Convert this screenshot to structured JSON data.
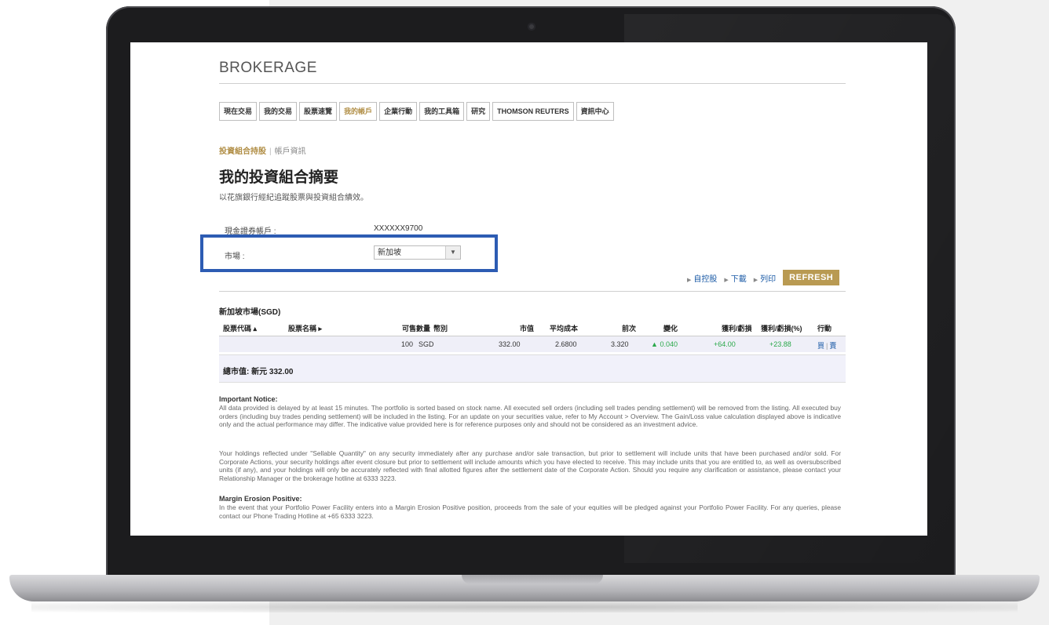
{
  "app": {
    "brand": "BROKERAGE"
  },
  "tabs": [
    {
      "label": "現在交易",
      "active": false
    },
    {
      "label": "我的交易",
      "active": false
    },
    {
      "label": "股票速覽",
      "active": false
    },
    {
      "label": "我的帳戶",
      "active": true
    },
    {
      "label": "企業行動",
      "active": false
    },
    {
      "label": "我的工具箱",
      "active": false
    },
    {
      "label": "研究",
      "active": false
    },
    {
      "label": "THOMSON REUTERS",
      "active": false
    },
    {
      "label": "資訊中心",
      "active": false
    }
  ],
  "subnav": {
    "active": "投資組合持股",
    "sep": "|",
    "other": "帳戶資訊"
  },
  "page": {
    "title": "我的投資組合摘要",
    "description": "以花旗銀行經紀追蹤股票與投資組合績效。"
  },
  "account": {
    "label": "現金證券帳戶 :",
    "value": "XXXXXX9700"
  },
  "market": {
    "label": "市場 :",
    "selected": "新加坡"
  },
  "actions": {
    "links": [
      "自控股",
      "下載",
      "列印"
    ],
    "refresh": "REFRESH"
  },
  "holdings": {
    "market_title": "新加坡市場(SGD)",
    "headers": {
      "code": "股票代碼 ▴",
      "name": "股票名稱 ▸",
      "qty": "可售數量",
      "currency": "幣別",
      "market_value": "市值",
      "avg_cost": "平均成本",
      "prev": "前次",
      "change": "變化",
      "pl": "獲利/虧損",
      "pl_pct": "獲利/虧損(%)",
      "action": "行動"
    },
    "rows": [
      {
        "code": "",
        "name": "",
        "qty": "100",
        "currency": "SGD",
        "market_value": "332.00",
        "avg_cost": "2.6800",
        "prev": "3.320",
        "change": "0.040",
        "pl": "+64.00",
        "pl_pct": "+23.88",
        "buy": "買",
        "sep": "|",
        "sell": "賣"
      }
    ],
    "total": "總市值: 新元 332.00"
  },
  "notices": {
    "important_title": "Important Notice:",
    "important_body": "All data provided is delayed by at least 15 minutes. The portfolio is sorted based on stock name. All executed sell orders (including sell trades pending settlement) will be removed from the listing. All executed buy orders (including buy trades pending settlement) will be included in the listing. For an update on your securities value, refer to My Account > Overview. The Gain/Loss value calculation displayed above is indicative only and the actual performance may differ. The indicative value provided here is for reference purposes only and should not be considered as an investment advice.",
    "holdings_body": "Your holdings reflected under \"Sellable Quantity\" on any security immediately after any purchase and/or sale transaction, but prior to settlement will include units that have been purchased and/or sold. For Corporate Actions, your security holdings after event closure but prior to settlement will include amounts which you have elected to receive. This may include units that you are entitled to, as well as oversubscribed units (if any), and your holdings will only be accurately reflected with final allotted figures after the settlement date of the Corporate Action. Should you require any clarification or assistance, please contact your Relationship Manager or the brokerage hotline at 6333 3223.",
    "margin_title": "Margin Erosion Positive:",
    "margin_body": "In the event that your Portfolio Power Facility enters into a Margin Erosion Positive position, proceeds from the sale of your equities will be pledged against your Portfolio Power Facility. For any queries, please contact our Phone Trading Hotline at +65 6333 3223."
  },
  "colors": {
    "accent": "#b08d44",
    "refresh_bg": "#b99a52",
    "highlight": "#2d5cb3",
    "link": "#1a5aa6",
    "up": "#2aa84a"
  }
}
